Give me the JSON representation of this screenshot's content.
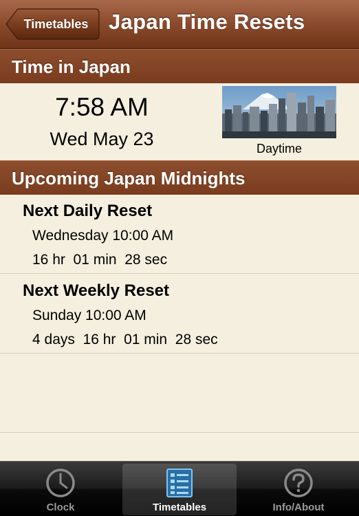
{
  "navbar": {
    "back_label": "Timetables",
    "title": "Japan Time Resets"
  },
  "time_section": {
    "header": "Time in Japan",
    "time": "7:58 AM",
    "date": "Wed May 23",
    "image_icon": "tokyo-skyline-image",
    "image_caption": "Daytime"
  },
  "midnights_section": {
    "header": "Upcoming Japan Midnights",
    "resets": [
      {
        "title": "Next Daily Reset",
        "day": "Wednesday 10:00 AM",
        "countdown": "16 hr  01 min  28 sec"
      },
      {
        "title": "Next Weekly Reset",
        "day": "Sunday 10:00 AM",
        "countdown": "4 days  16 hr  01 min  28 sec"
      }
    ]
  },
  "tabbar": {
    "tabs": [
      {
        "label": "Clock",
        "icon": "clock-icon",
        "selected": false
      },
      {
        "label": "Timetables",
        "icon": "list-icon",
        "selected": true
      },
      {
        "label": "Info/About",
        "icon": "question-icon",
        "selected": false
      }
    ]
  },
  "colors": {
    "header_brown": "#7a3c1e",
    "background_cream": "#f5efdf",
    "tab_selected_icon": "#4aa8e8"
  }
}
